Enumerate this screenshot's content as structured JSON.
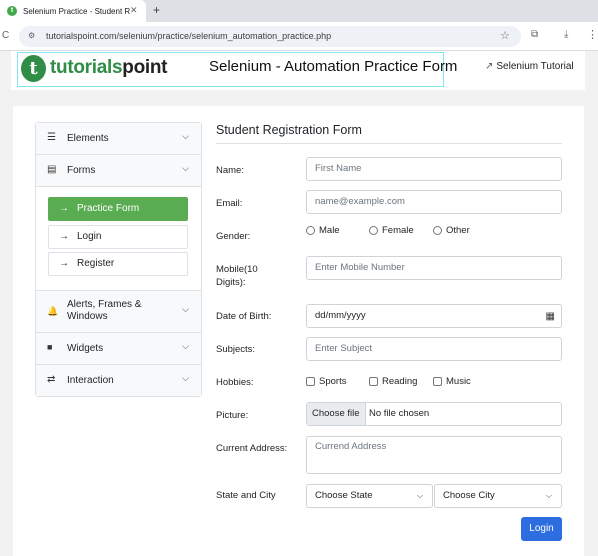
{
  "browser": {
    "tab_title": "Selenium Practice - Student R",
    "tab_favicon": "t",
    "close_glyph": "✕",
    "new_tab_glyph": "+",
    "reload_glyph": "C",
    "site_info_glyph": "⚙",
    "url": "tutorialspoint.com/selenium/practice/selenium_automation_practice.php",
    "star_glyph": "☆",
    "extensions_glyph": "⧉",
    "download_glyph": "⤓",
    "menu_glyph": "⋮",
    "icons": [
      "close-icon",
      "plus-icon",
      "reload-icon",
      "site-info-icon",
      "star-icon",
      "extensions-icon",
      "download-icon",
      "menu-icon"
    ]
  },
  "header": {
    "logo_mark": "t",
    "logo_brand_a": "tutorials",
    "logo_brand_b": "point",
    "title": "Selenium - Automation Practice Form",
    "link_icon": "↗",
    "link_label": "Selenium Tutorial"
  },
  "sidebar": {
    "items": [
      {
        "icon_glyph": "☰",
        "icon": "hamburger-icon",
        "label": "Elements",
        "chevron": "⌵"
      },
      {
        "icon_glyph": "▤",
        "icon": "form-icon",
        "label": "Forms",
        "chevron": "⌵"
      },
      {
        "icon_glyph": "🔔",
        "icon": "bell-icon",
        "label": "Alerts, Frames & Windows",
        "chevron": "⌵"
      },
      {
        "icon_glyph": "■",
        "icon": "widgets-icon",
        "label": "Widgets",
        "chevron": "⌵"
      },
      {
        "icon_glyph": "⇄",
        "icon": "interaction-icon",
        "label": "Interaction",
        "chevron": "⌵"
      }
    ],
    "forms_subitems": [
      {
        "arrow": "→",
        "label": "Practice Form",
        "active": true
      },
      {
        "arrow": "→",
        "label": "Login",
        "active": false
      },
      {
        "arrow": "→",
        "label": "Register",
        "active": false
      }
    ]
  },
  "form": {
    "title": "Student Registration Form",
    "name": {
      "label": "Name:",
      "placeholder": "First Name"
    },
    "email": {
      "label": "Email:",
      "placeholder": "name@example.com"
    },
    "gender": {
      "label": "Gender:",
      "options": [
        "Male",
        "Female",
        "Other"
      ]
    },
    "mobile": {
      "label_line1": "Mobile(10",
      "label_line2": "Digits):",
      "placeholder": "Enter Mobile Number"
    },
    "dob": {
      "label": "Date of Birth:",
      "value": "dd/mm/yyyy",
      "icon_glyph": "▦"
    },
    "subjects": {
      "label": "Subjects:",
      "placeholder": "Enter Subject"
    },
    "hobbies": {
      "label": "Hobbies:",
      "options": [
        "Sports",
        "Reading",
        "Music"
      ]
    },
    "picture": {
      "label": "Picture:",
      "button": "Choose file",
      "status": "No file chosen"
    },
    "address": {
      "label": "Current Address:",
      "placeholder": "Currend Address"
    },
    "state_city": {
      "label": "State and City",
      "state": "Choose State",
      "city": "Choose City",
      "chevron": "⌵"
    },
    "submit": "Login"
  },
  "colors": {
    "accent_green": "#5aac52",
    "brand_green": "#2f8d46",
    "primary_blue": "#2c6ddf"
  }
}
